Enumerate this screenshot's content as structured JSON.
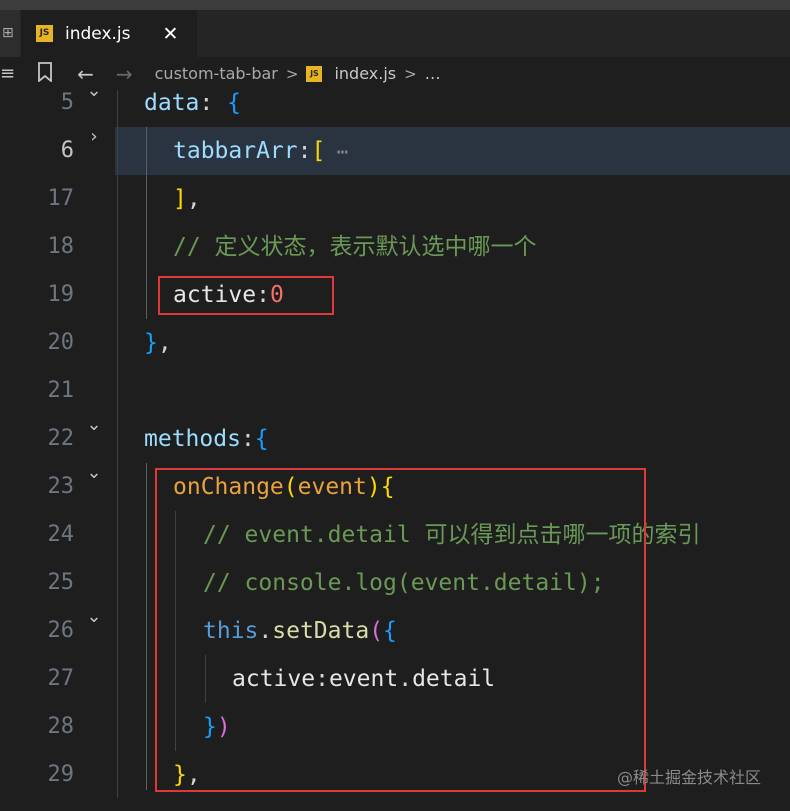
{
  "tabs": {
    "edge_glyph": "⊞",
    "active": {
      "icon": "js-file-icon",
      "icon_text": "JS",
      "name": "index.js",
      "close": "✕"
    }
  },
  "breadcrumb": {
    "items": [
      "custom-tab-bar",
      "index.js",
      "…"
    ],
    "separator": ">",
    "icons": [
      "list-icon",
      "bookmark-icon",
      "arrow-left-icon",
      "arrow-right-icon"
    ]
  },
  "editor": {
    "line_numbers": [
      "5",
      "6",
      "17",
      "18",
      "19",
      "20",
      "21",
      "22",
      "23",
      "24",
      "25",
      "26",
      "27",
      "28",
      "29"
    ],
    "code": {
      "l5": {
        "a": "data",
        "b": ": ",
        "c": "{"
      },
      "l6": {
        "a": "tabbarArr",
        "b": ":",
        "c": "[",
        "d": " ⋯"
      },
      "l17": {
        "a": "]",
        "b": ","
      },
      "l18": {
        "a": "// 定义状态，表示默认选中哪一个"
      },
      "l19": {
        "a": "active",
        "b": ":",
        "c": "0"
      },
      "l20": {
        "a": "}",
        "b": ","
      },
      "l22": {
        "a": "methods",
        "b": ":",
        "c": "{"
      },
      "l23": {
        "a": "onChange",
        "b": "(",
        "c": "event",
        "d": ")",
        "e": "{"
      },
      "l24": {
        "a": "// event.detail 可以得到点击哪一项的索引"
      },
      "l25": {
        "a": "// console.log(event.detail);"
      },
      "l26": {
        "a": "this",
        "b": ".",
        "c": "setData",
        "d": "(",
        "e": "{"
      },
      "l27": {
        "a": "active",
        "b": ":",
        "c": "event",
        "d": ".",
        "e": "detail"
      },
      "l28": {
        "a": "}",
        "b": ")"
      },
      "l29": {
        "a": "}",
        "b": ","
      }
    }
  },
  "watermark": "@稀土掘金技术社区",
  "colors": {
    "background": "#1e1e1e",
    "highlight_box": "#e03838",
    "comment": "#6a9955",
    "property": "#9cdcfe"
  }
}
